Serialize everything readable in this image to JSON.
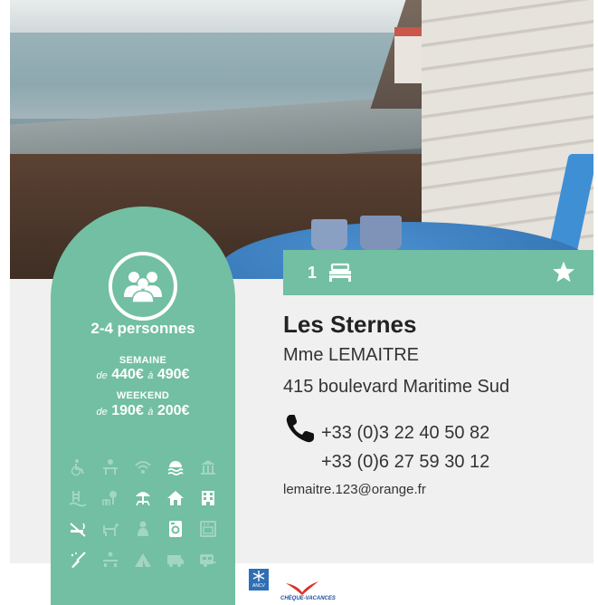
{
  "listing": {
    "name": "Les Sternes",
    "owner": "Mme LEMAITRE",
    "address": "415 boulevard Maritime Sud",
    "phones": [
      "+33 (0)3 22 40 50 82",
      "+33 (0)6 27 59 30 12"
    ],
    "email": "lemaitre.123@orange.fr"
  },
  "header_bar": {
    "rooms": "1",
    "bed_icon": "bed-icon",
    "star_icon": "star-icon"
  },
  "capacity": {
    "label": "2-4 personnes",
    "icon": "people-icon"
  },
  "pricing": {
    "week_label": "SEMAINE",
    "week_from": "de",
    "week_min": "440€",
    "week_to": "à",
    "week_max": "490€",
    "weekend_label": "WEEKEND",
    "weekend_from": "de",
    "weekend_min": "190€",
    "weekend_to": "à",
    "weekend_max": "200€"
  },
  "amenities": [
    {
      "icon": "wheelchair-icon",
      "active": false
    },
    {
      "icon": "terrace-icon",
      "active": false
    },
    {
      "icon": "wifi-icon",
      "active": false
    },
    {
      "icon": "sea-view-icon",
      "active": true
    },
    {
      "icon": "monument-icon",
      "active": false
    },
    {
      "icon": "pool-icon",
      "active": false
    },
    {
      "icon": "garden-icon",
      "active": false
    },
    {
      "icon": "parasol-table-icon",
      "active": true
    },
    {
      "icon": "house-icon",
      "active": true
    },
    {
      "icon": "building-icon",
      "active": true
    },
    {
      "icon": "no-smoking-icon",
      "active": true
    },
    {
      "icon": "pets-icon",
      "active": false
    },
    {
      "icon": "baby-icon",
      "active": false
    },
    {
      "icon": "washing-machine-icon",
      "active": true
    },
    {
      "icon": "oven-icon",
      "active": false
    },
    {
      "icon": "cleaning-icon",
      "active": true
    },
    {
      "icon": "meeting-room-icon",
      "active": false
    },
    {
      "icon": "tent-icon",
      "active": false
    },
    {
      "icon": "camper-icon",
      "active": false
    },
    {
      "icon": "caravan-icon",
      "active": false
    }
  ],
  "logos": {
    "ancv_caption": "ANCV",
    "cheque_vacances": "CHÈQUE-VACANCES"
  },
  "colors": {
    "accent_green": "#72bfa3",
    "card_bg": "#f0f0f0",
    "text": "#333333"
  }
}
